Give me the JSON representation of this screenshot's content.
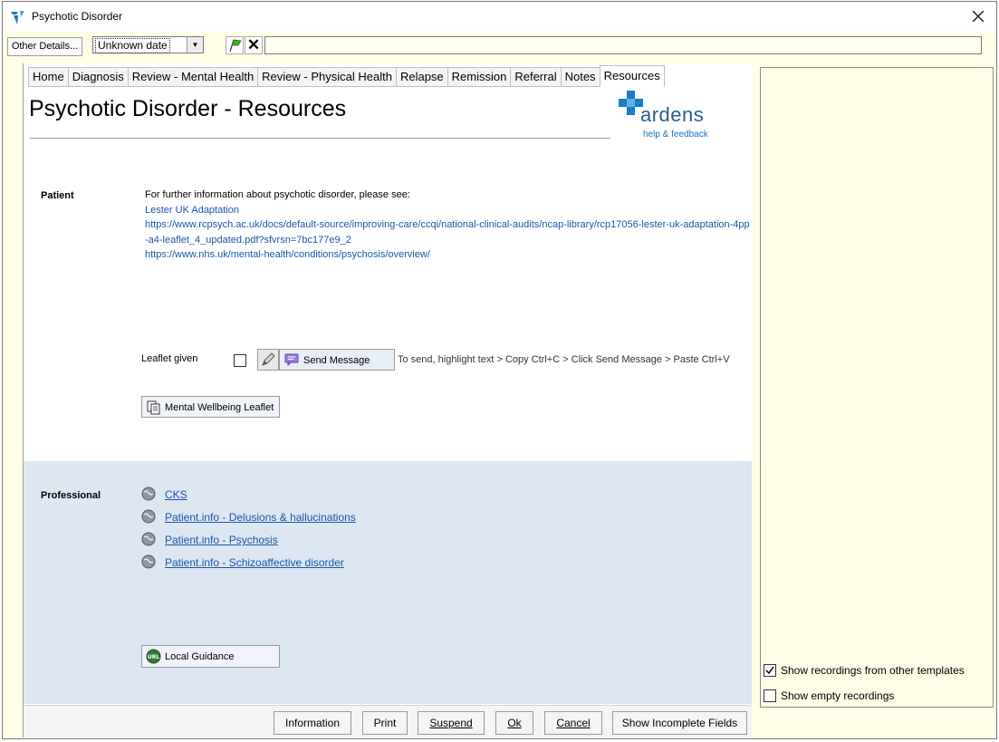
{
  "window": {
    "title": "Psychotic Disorder"
  },
  "toolbar": {
    "other_details_label": "Other Details...",
    "date_value": "Unknown date",
    "input_value": ""
  },
  "tabs": [
    {
      "label": "Home"
    },
    {
      "label": "Diagnosis"
    },
    {
      "label": "Review - Mental Health"
    },
    {
      "label": "Review - Physical Health"
    },
    {
      "label": "Relapse"
    },
    {
      "label": "Remission"
    },
    {
      "label": "Referral"
    },
    {
      "label": "Notes"
    },
    {
      "label": "Resources",
      "active": true
    }
  ],
  "page": {
    "title": "Psychotic Disorder - Resources",
    "logo_word": "ardens",
    "logo_sub": "help & feedback"
  },
  "patient": {
    "label": "Patient",
    "intro": "For further information about psychotic disorder, please see:",
    "links": [
      "Lester UK Adaptation",
      "https://www.rcpsych.ac.uk/docs/default-source/improving-care/ccqi/national-clinical-audits/ncap-library/rcp17056-lester-uk-adaptation-4pp-a4-leaflet_4_updated.pdf?sfvrsn=7bc177e9_2",
      "https://www.nhs.uk/mental-health/conditions/psychosis/overview/"
    ],
    "leaflet_label": "Leaflet given",
    "leaflet_checked": false,
    "send_message_label": "Send Message",
    "send_hint": "To send, highlight text > Copy Ctrl+C > Click Send Message > Paste Ctrl+V",
    "leaflet_button_label": "Mental Wellbeing Leaflet"
  },
  "professional": {
    "label": "Professional",
    "links": [
      "CKS",
      "Patient.info - Delusions & hallucinations",
      "Patient.info - Psychosis",
      "Patient.info - Schizoaffective disorder"
    ],
    "local_guidance_label": "Local Guidance"
  },
  "bottom_buttons": {
    "information": "Information",
    "print": "Print",
    "suspend": "Suspend",
    "ok": "Ok",
    "cancel": "Cancel",
    "incomplete": "Show Incomplete Fields"
  },
  "side_panel": {
    "show_other_templates": "Show recordings from other templates",
    "show_other_templates_checked": true,
    "show_empty": "Show empty recordings",
    "show_empty_checked": false
  },
  "colors": {
    "link": "#1a56a8",
    "panel_yellow": "#fffde6",
    "professional_bg": "#dde7f1",
    "logo_blue": "#2a5f8e"
  }
}
